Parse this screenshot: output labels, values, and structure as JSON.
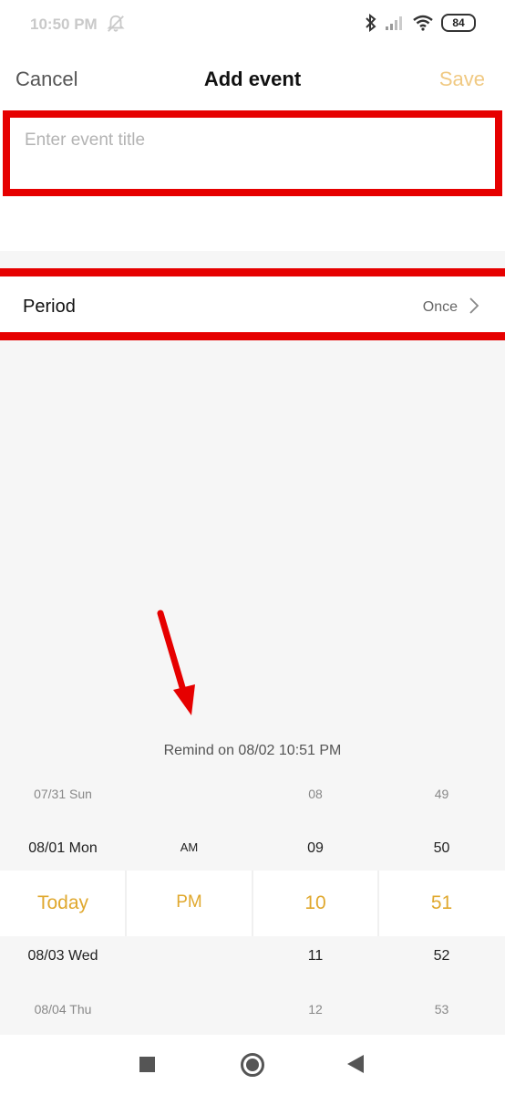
{
  "status_bar": {
    "time": "10:50 PM",
    "battery": "84"
  },
  "header": {
    "cancel_label": "Cancel",
    "title": "Add event",
    "save_label": "Save"
  },
  "event_title": {
    "value": "",
    "placeholder": "Enter event title"
  },
  "period": {
    "label": "Period",
    "value": "Once"
  },
  "remind_text": "Remind on 08/02 10:51 PM",
  "picker": {
    "days": [
      "07/31 Sun",
      "08/01 Mon",
      "Today",
      "08/03 Wed",
      "08/04 Thu"
    ],
    "ampm": [
      "",
      "AM",
      "PM",
      "",
      ""
    ],
    "hours": [
      "08",
      "09",
      "10",
      "11",
      "12"
    ],
    "minutes": [
      "49",
      "50",
      "51",
      "52",
      "53"
    ]
  },
  "colors": {
    "accent": "#e0a82e",
    "save_disabled": "#f0c982",
    "highlight": "#e60000"
  }
}
